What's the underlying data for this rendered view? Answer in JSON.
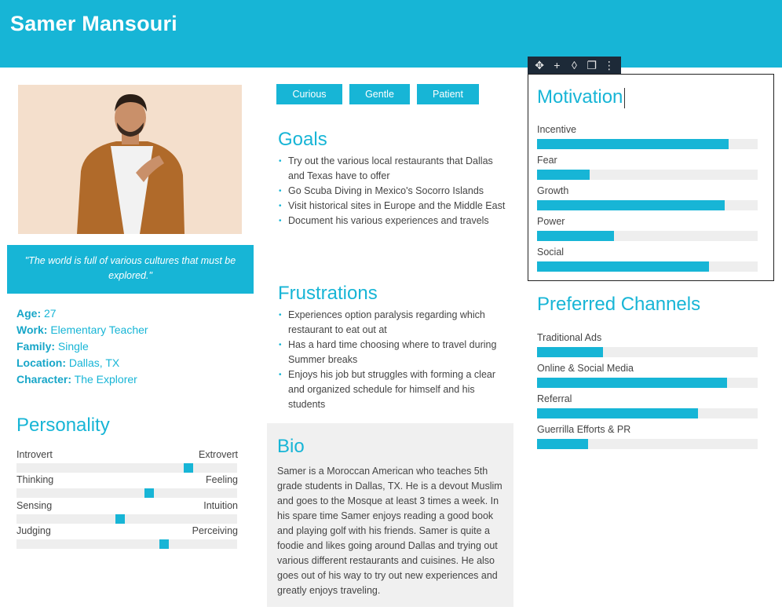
{
  "header": {
    "name": "Samer Mansouri"
  },
  "quote": "\"The world is full of various cultures that must be explored.\"",
  "facts": [
    {
      "key": "Age:",
      "value": "27"
    },
    {
      "key": "Work:",
      "value": "Elementary Teacher"
    },
    {
      "key": "Family:",
      "value": "Single"
    },
    {
      "key": "Location:",
      "value": "Dallas, TX"
    },
    {
      "key": "Character:",
      "value": "The Explorer"
    }
  ],
  "personality": {
    "title": "Personality",
    "traits": [
      {
        "left": "Introvert",
        "right": "Extrovert",
        "level": 0.78
      },
      {
        "left": "Thinking",
        "right": "Feeling",
        "level": 0.6
      },
      {
        "left": "Sensing",
        "right": "Intuition",
        "level": 0.47
      },
      {
        "left": "Judging",
        "right": "Perceiving",
        "level": 0.67
      }
    ]
  },
  "tags": [
    "Curious",
    "Gentle",
    "Patient"
  ],
  "goals": {
    "title": "Goals",
    "items": [
      "Try out the various local restaurants that Dallas and Texas have to offer",
      "Go Scuba Diving in Mexico's Socorro Islands",
      "Visit historical sites in Europe and the Middle East",
      "Document his various experiences and travels"
    ]
  },
  "frustrations": {
    "title": "Frustrations",
    "items": [
      "Experiences option paralysis regarding which restaurant to eat out at",
      "Has a hard time choosing where to travel during Summer breaks",
      "Enjoys his job but struggles with forming a clear and organized schedule for himself and his students"
    ]
  },
  "bio": {
    "title": "Bio",
    "text": "Samer is a Moroccan American who teaches 5th grade students in Dallas, TX.  He is a devout Muslim and goes to the Mosque at least 3 times a week. In his spare time Samer enjoys reading a good book and playing golf with his friends. Samer is quite a foodie and likes going around Dallas and trying out various different restaurants and cuisines. He also goes out of his way to try out new experiences and greatly enjoys traveling."
  },
  "motivation": {
    "title": "Motivation",
    "items": [
      {
        "label": "Incentive",
        "level": 0.87
      },
      {
        "label": "Fear",
        "level": 0.24
      },
      {
        "label": "Growth",
        "level": 0.85
      },
      {
        "label": "Power",
        "level": 0.35
      },
      {
        "label": "Social",
        "level": 0.78
      }
    ]
  },
  "channels": {
    "title": "Preferred Channels",
    "items": [
      {
        "label": "Traditional Ads",
        "level": 0.3
      },
      {
        "label": "Online & Social Media",
        "level": 0.86
      },
      {
        "label": "Referral",
        "level": 0.73
      },
      {
        "label": "Guerrilla Efforts & PR",
        "level": 0.23
      }
    ]
  },
  "toolbar": {
    "icons": [
      "move-icon",
      "add-icon",
      "fill-color-icon",
      "duplicate-icon",
      "more-icon"
    ],
    "glyphs": [
      "✥",
      "+",
      "◊",
      "❐",
      "⋮"
    ]
  },
  "colors": {
    "accent": "#17b5d6",
    "track": "#eeeeee",
    "bio_bg": "#f0f0f0",
    "toolbar": "#1d2a38"
  }
}
